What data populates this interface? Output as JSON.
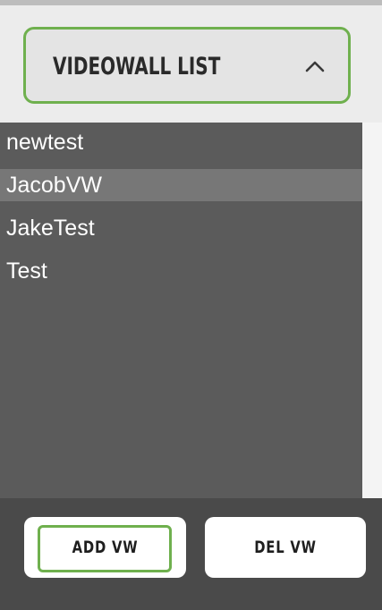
{
  "header": {
    "title": "VIDEOWALL LIST",
    "toggle_icon": "chevron-up-icon"
  },
  "list": {
    "items": [
      {
        "label": "newtest",
        "selected": false
      },
      {
        "label": "JacobVW",
        "selected": true
      },
      {
        "label": "JakeTest",
        "selected": false
      },
      {
        "label": "Test",
        "selected": false
      }
    ]
  },
  "actions": {
    "add_label": "ADD VW",
    "del_label": "DEL VW"
  },
  "colors": {
    "focus_outline": "#6fb04e",
    "list_background": "#5b5b5b",
    "selected_row": "#777777",
    "bottom_bar": "#4a4a4a"
  }
}
